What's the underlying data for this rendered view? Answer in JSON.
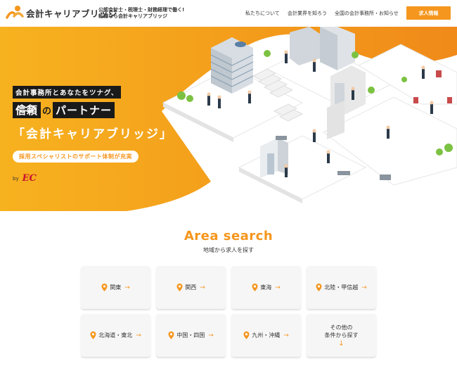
{
  "header": {
    "logo_text": "会計キャリアブリッジ",
    "tagline_line1": "公認会計士・税理士・財務経理で働く!",
    "tagline_line2": "転職なら会計キャリアブリッジ",
    "nav": [
      {
        "label": "私たちについて"
      },
      {
        "label": "会計業界を知ろう"
      },
      {
        "label": "全国の会計事務所・お知らせ"
      }
    ],
    "cta_label": "求人情報"
  },
  "hero": {
    "line1": "会計事務所とあなたをツナグ、",
    "line2_box": "信頼",
    "line2_no": "の",
    "line2_box2": "パートナー",
    "line3": "「会計キャリアブリッジ」",
    "line4": "採用スペシャリストのサポート体制が充実",
    "by": "by",
    "by_logo": "EC"
  },
  "area": {
    "title": "Area search",
    "subtitle": "地域から求人を探す",
    "regions": [
      {
        "label": "関東"
      },
      {
        "label": "関西"
      },
      {
        "label": "東海"
      },
      {
        "label": "北陸・甲信越"
      },
      {
        "label": "北海道・東北"
      },
      {
        "label": "中国・四国"
      },
      {
        "label": "九州・沖縄"
      }
    ],
    "other_line1": "その他の",
    "other_line2": "条件から探す"
  },
  "colors": {
    "accent": "#f5961e",
    "dark": "#1a1a1a",
    "card": "#f6f6f6"
  }
}
